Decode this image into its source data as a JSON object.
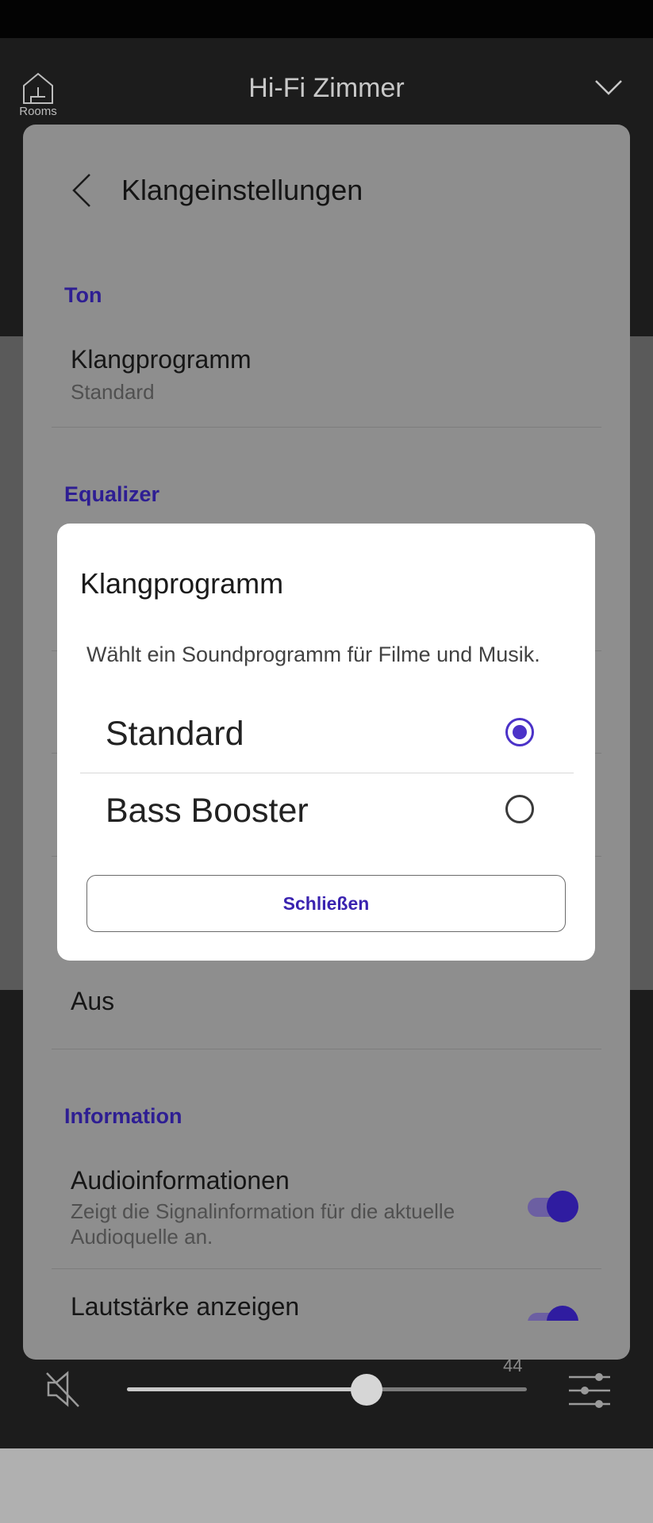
{
  "header": {
    "rooms_label": "Rooms",
    "room_title": "Hi-Fi Zimmer"
  },
  "player": {
    "volume_value": "44",
    "volume_level_fraction": 0.6
  },
  "sheet": {
    "title": "Klangeinstellungen",
    "sections": {
      "ton": "Ton",
      "equalizer": "Equalizer",
      "information": "Information"
    },
    "items": {
      "klangprogramm_title": "Klangprogramm",
      "klangprogramm_value": "Standard",
      "aus_value": "Aus",
      "audioinfo_title": "Audioinformationen",
      "audioinfo_desc": "Zeigt die Signalinformation für die aktuelle Audioquelle an.",
      "lautstaerke_title": "Lautstärke anzeigen"
    }
  },
  "dialog": {
    "title": "Klangprogramm",
    "description": "Wählt ein Soundprogramm für Filme und Musik.",
    "options": [
      {
        "label": "Standard",
        "selected": true
      },
      {
        "label": "Bass Booster",
        "selected": false
      }
    ],
    "close_label": "Schließen"
  },
  "colors": {
    "accent": "#4b32c8",
    "section_title": "#2e1e93"
  }
}
